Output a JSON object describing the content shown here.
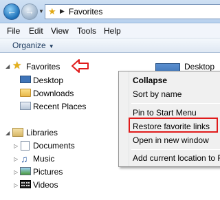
{
  "address_bar": {
    "location": "Favorites"
  },
  "menubar": {
    "items": [
      "File",
      "Edit",
      "View",
      "Tools",
      "Help"
    ]
  },
  "toolbar": {
    "organize_label": "Organize"
  },
  "navigation": {
    "favorites_label": "Favorites",
    "favorites_items": [
      "Desktop",
      "Downloads",
      "Recent Places"
    ],
    "libraries_label": "Libraries",
    "libraries_items": [
      "Documents",
      "Music",
      "Pictures",
      "Videos"
    ]
  },
  "content": {
    "item_label": "Desktop"
  },
  "context_menu": {
    "items": [
      "Collapse",
      "Sort by name",
      "Pin to Start Menu",
      "Restore favorite links",
      "Open in new window",
      "Add current location to Fav"
    ]
  },
  "colors": {
    "annotation_red": "#e01b1b",
    "favorite_star": "#e6b11a"
  },
  "icons": {
    "back": "back-arrow-icon",
    "forward": "forward-arrow-icon",
    "favorites": "star-icon",
    "desktop": "desktop-icon",
    "downloads": "folder-icon",
    "recent": "recent-places-icon",
    "libraries": "library-icon",
    "documents": "document-icon",
    "music": "music-icon",
    "pictures": "pictures-icon",
    "videos": "video-icon"
  }
}
